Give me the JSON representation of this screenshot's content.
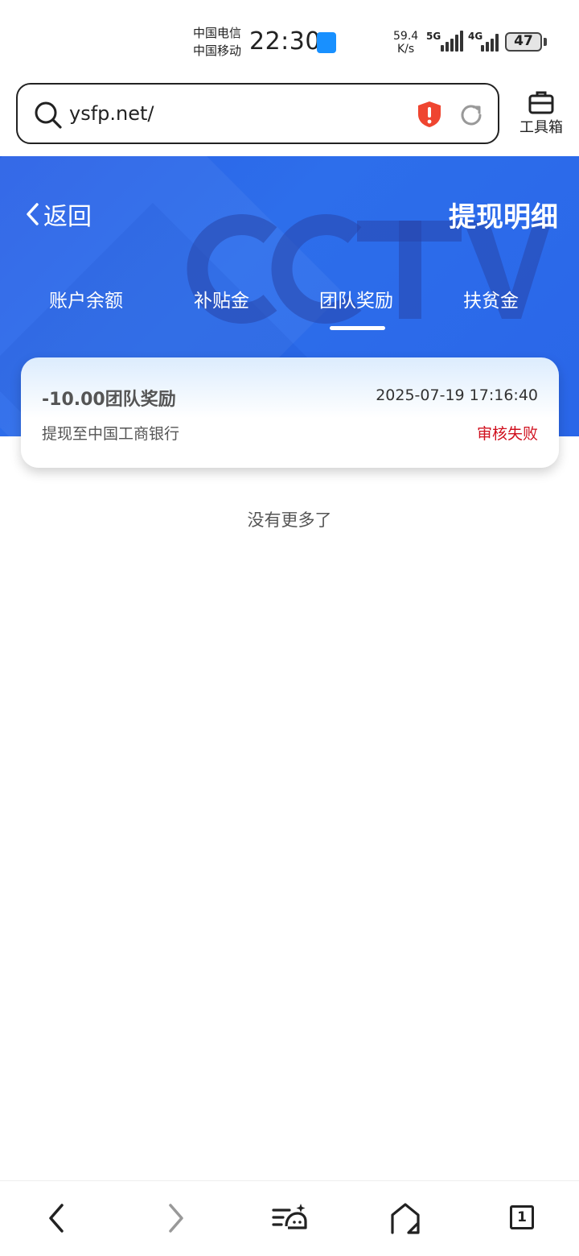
{
  "status_bar": {
    "carrier1": "中国电信",
    "carrier2": "中国移动",
    "time": "22:30",
    "net_speed_value": "59.4",
    "net_speed_unit": "K/s",
    "signal1_label": "5G",
    "signal2_label": "4G",
    "battery": "47"
  },
  "browser": {
    "url": "ysfp.net/",
    "toolbox_label": "工具箱"
  },
  "header": {
    "back_label": "返回",
    "title": "提现明细",
    "tabs": [
      {
        "label": "账户余额"
      },
      {
        "label": "补贴金"
      },
      {
        "label": "团队奖励"
      },
      {
        "label": "扶贫金"
      }
    ],
    "active_tab": "团队奖励"
  },
  "records": [
    {
      "amount": "-10.00团队奖励",
      "time": "2025-07-19 17:16:40",
      "desc": "提现至中国工商银行",
      "status": "审核失败"
    }
  ],
  "footer_text": "没有更多了",
  "tab_count": "1",
  "colors": {
    "header_blue": "#2b62e6",
    "status_fail": "#d0101e"
  },
  "icons": [
    "search-icon",
    "shield-alert-icon",
    "refresh-icon",
    "toolbox-icon",
    "chevron-left-icon",
    "back-icon",
    "forward-icon",
    "menu-icon",
    "home-icon",
    "tabs-icon"
  ]
}
